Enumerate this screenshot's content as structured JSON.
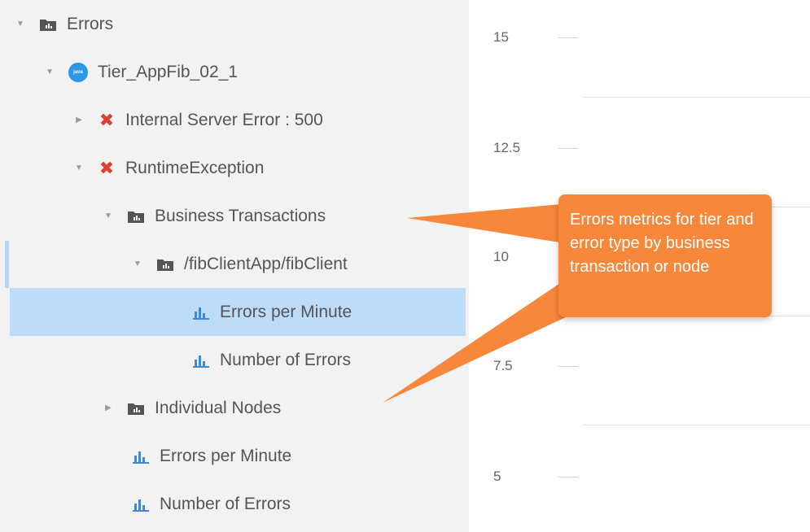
{
  "tree": {
    "items": [
      {
        "label": "Errors",
        "icon": "folder-icon",
        "arrow": "expanded"
      },
      {
        "label": "Tier_AppFib_02_1",
        "icon": "java-node-icon",
        "icon_text": "java",
        "arrow": "expanded"
      },
      {
        "label": "Internal Server Error : 500",
        "icon": "error-icon",
        "arrow": "collapsed"
      },
      {
        "label": "RuntimeException",
        "icon": "error-icon",
        "arrow": "expanded"
      },
      {
        "label": "Business Transactions",
        "icon": "folder-icon",
        "arrow": "expanded"
      },
      {
        "label": "/fibClientApp/fibClient",
        "icon": "folder-icon",
        "arrow": "expanded"
      },
      {
        "label": "Errors per Minute",
        "icon": "metric-icon",
        "selected": true
      },
      {
        "label": "Number of Errors",
        "icon": "metric-icon"
      },
      {
        "label": "Individual Nodes",
        "icon": "folder-icon",
        "arrow": "collapsed"
      },
      {
        "label": "Errors per Minute",
        "icon": "metric-icon"
      },
      {
        "label": "Number of Errors",
        "icon": "metric-icon"
      }
    ]
  },
  "chart": {
    "y_ticks": [
      "15",
      "12.5",
      "10",
      "7.5",
      "5"
    ]
  },
  "callout": {
    "text": "Errors metrics for tier and error type by business transaction or node",
    "color": "#f7873a"
  },
  "colors": {
    "selected_row": "#bcdcf8",
    "error_icon": "#e23e2f",
    "metric_icon": "#3f88db",
    "node_icon": "#2b97e8"
  }
}
